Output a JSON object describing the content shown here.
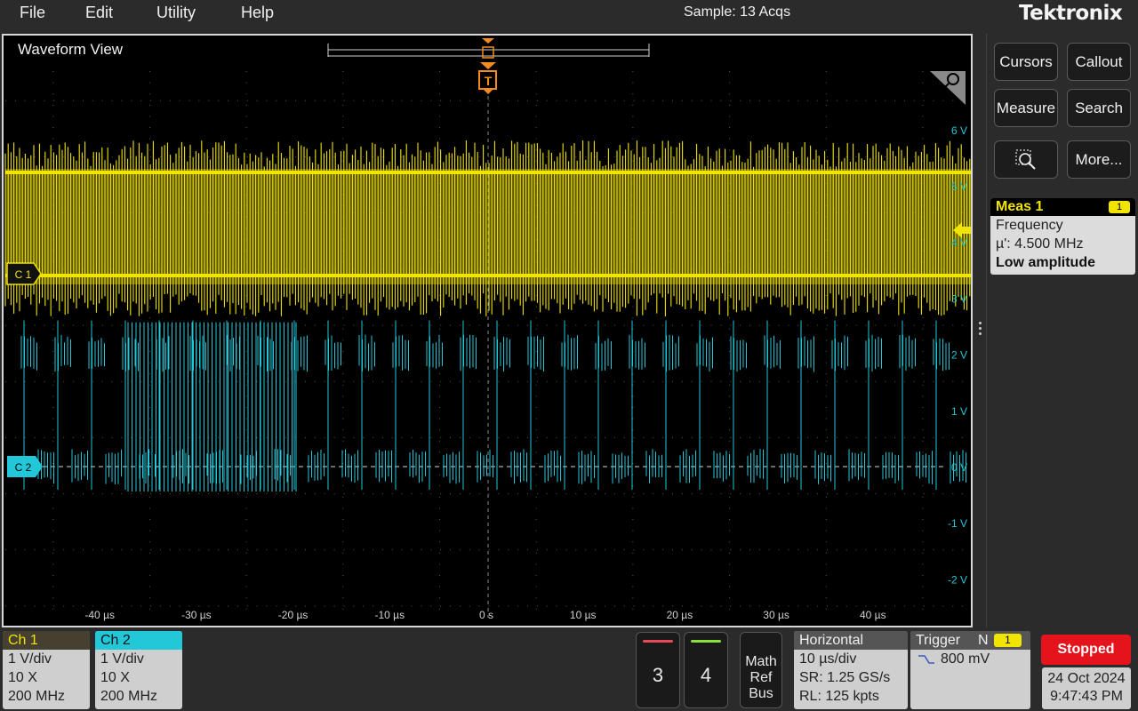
{
  "menu": {
    "file": "File",
    "edit": "Edit",
    "utility": "Utility",
    "help": "Help"
  },
  "status": {
    "acquisition": "Sample: 13 Acqs"
  },
  "brand": {
    "logo": "Tektronix"
  },
  "waveform_view": {
    "title": "Waveform View",
    "trigger_marker": "T",
    "y_labels": [
      "6 V",
      "5 V",
      "4 V",
      "3 V",
      "2 V",
      "1 V",
      "0 V",
      "-1 V",
      "-2 V"
    ],
    "x_labels": [
      "-40 µs",
      "-30 µs",
      "-20 µs",
      "-10 µs",
      "0 s",
      "10 µs",
      "20 µs",
      "30 µs",
      "40 µs"
    ],
    "ch1_marker": "C 1",
    "ch2_marker": "C 2",
    "colors": {
      "ch1": "#f0e400",
      "ch2": "#22c8d8",
      "trigger": "#f28c1e",
      "grid": "#5a5a5a"
    }
  },
  "right_panel": {
    "cursors": "Cursors",
    "callout": "Callout",
    "measure": "Measure",
    "search": "Search",
    "more": "More...",
    "zoom_icon": "zoom-icon"
  },
  "meas1": {
    "title": "Meas 1",
    "channel": "1",
    "name": "Frequency",
    "value": "µ': 4.500 MHz",
    "warning": "Low amplitude"
  },
  "ch1": {
    "title": "Ch 1",
    "scale": "1 V/div",
    "probe": "10 X",
    "bandwidth": "200 MHz",
    "color": "#f0e400"
  },
  "ch2": {
    "title": "Ch 2",
    "scale": "1 V/div",
    "probe": "10 X",
    "bandwidth": "200 MHz",
    "color": "#22c8d8"
  },
  "channel_buttons": [
    {
      "label": "3",
      "color": "#e84a5a"
    },
    {
      "label": "4",
      "color": "#8ce03a"
    }
  ],
  "math_ref_bus": {
    "line1": "Math",
    "line2": "Ref",
    "line3": "Bus"
  },
  "horizontal": {
    "title": "Horizontal",
    "scale": "10 µs/div",
    "sample_rate": "SR: 1.25 GS/s",
    "record_length": "RL: 125 kpts"
  },
  "trigger": {
    "title": "Trigger",
    "mode": "N",
    "source": "1",
    "level": "800 mV",
    "slope_icon": "falling-edge-icon"
  },
  "run_state": {
    "label": "Stopped"
  },
  "datetime": {
    "date": "24 Oct 2024",
    "time": "9:47:43 PM"
  }
}
